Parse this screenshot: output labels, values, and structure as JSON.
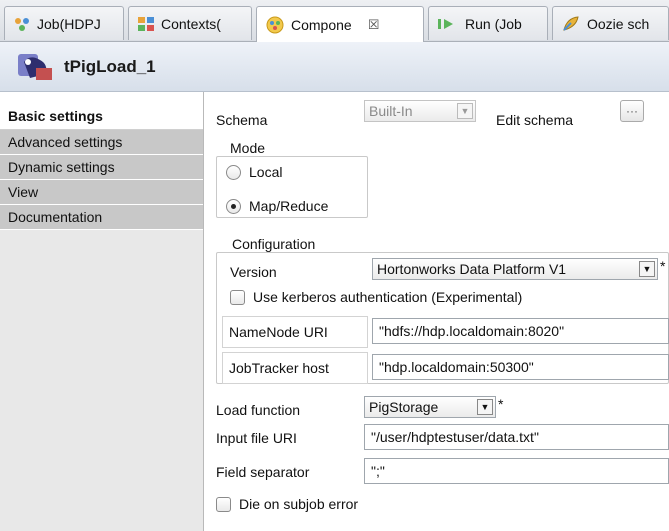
{
  "tabs": [
    {
      "label": "Job(HDPJ",
      "icon": "job-icon"
    },
    {
      "label": "Contexts(",
      "icon": "contexts-icon"
    },
    {
      "label": "Compone",
      "icon": "component-icon",
      "close": "☒"
    },
    {
      "label": "Run (Job",
      "icon": "run-icon"
    },
    {
      "label": "Oozie sch",
      "icon": "oozie-icon"
    }
  ],
  "header": {
    "title": "tPigLoad_1"
  },
  "sidebar": {
    "items": [
      {
        "label": "Basic settings"
      },
      {
        "label": "Advanced settings"
      },
      {
        "label": "Dynamic settings"
      },
      {
        "label": "View"
      },
      {
        "label": "Documentation"
      }
    ]
  },
  "schema": {
    "label": "Schema",
    "value": "Built-In",
    "edit_label": "Edit schema",
    "edit_button": "···"
  },
  "mode": {
    "label": "Mode",
    "local": "Local",
    "mapreduce": "Map/Reduce",
    "selected": "mapreduce"
  },
  "configuration": {
    "label": "Configuration",
    "version_label": "Version",
    "version_value": "Hortonworks Data Platform V1",
    "kerberos_label": "Use kerberos authentication (Experimental)",
    "namenode_label": "NameNode URI",
    "namenode_value": "\"hdfs://hdp.localdomain:8020\"",
    "jobtracker_label": "JobTracker host",
    "jobtracker_value": "\"hdp.localdomain:50300\""
  },
  "load": {
    "function_label": "Load function",
    "function_value": "PigStorage",
    "input_label": "Input file URI",
    "input_value": "\"/user/hdptestuser/data.txt\"",
    "separator_label": "Field separator",
    "separator_value": "\";\"",
    "die_label": "Die on subjob error"
  },
  "required_mark": "*"
}
